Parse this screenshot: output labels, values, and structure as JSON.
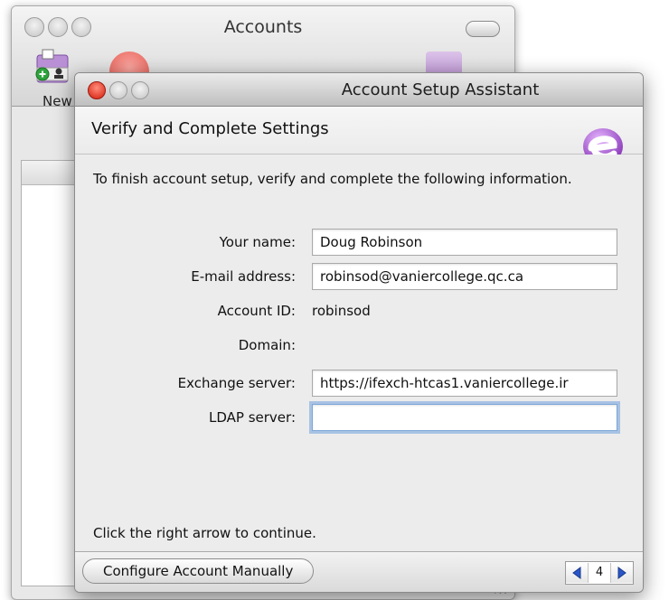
{
  "background_window": {
    "title": "Accounts",
    "new_label": "New"
  },
  "dialog": {
    "title": "Account Setup Assistant",
    "heading": "Verify and Complete Settings",
    "intro": "To finish account setup, verify and complete the following information.",
    "fields": {
      "your_name": {
        "label": "Your name:",
        "value": "Doug Robinson"
      },
      "email": {
        "label": "E-mail address:",
        "value": "robinsod@vaniercollege.qc.ca"
      },
      "account_id": {
        "label": "Account ID:",
        "value": "robinsod"
      },
      "domain": {
        "label": "Domain:",
        "value": ""
      },
      "exchange_server": {
        "label": "Exchange server:",
        "value": "https://ifexch-htcas1.vaniercollege.ir"
      },
      "ldap_server": {
        "label": "LDAP server:",
        "value": ""
      }
    },
    "continue_hint": "Click the right arrow to continue.",
    "footer": {
      "manual_button": "Configure Account Manually",
      "page_number": "4"
    }
  },
  "colors": {
    "close_button": "#d41c0b",
    "entourage_brand": "#9b4fc1",
    "pager_arrow": "#2a56c8",
    "focus_ring": "#6fa0dc"
  },
  "icons": [
    "new-account-icon",
    "entourage-logo-icon",
    "previous-arrow-icon",
    "next-arrow-icon"
  ]
}
